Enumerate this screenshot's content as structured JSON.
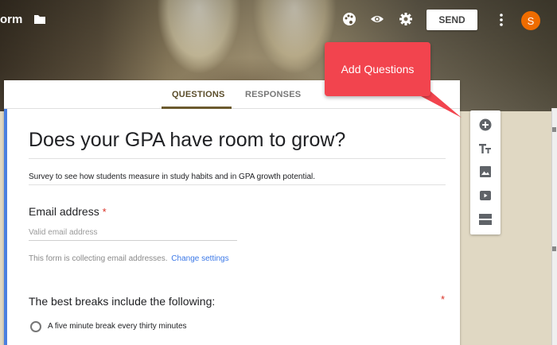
{
  "topbar": {
    "app_title": "orm",
    "send_label": "SEND",
    "avatar_initial": "S"
  },
  "tabs": [
    {
      "label": "QUESTIONS"
    },
    {
      "label": "RESPONSES"
    }
  ],
  "form": {
    "title": "Does your GPA have room to grow?",
    "description": "Survey to see how students measure in study habits and in GPA growth potential."
  },
  "email": {
    "label": "Email address",
    "required_mark": "*",
    "placeholder": "Valid email address",
    "collecting_note": "This form is collecting email addresses.",
    "change_settings": "Change settings"
  },
  "question": {
    "label": "The best breaks include the following:",
    "required_mark": "*",
    "options": [
      "A five minute break every thirty minutes"
    ]
  },
  "callout": {
    "text": "Add Questions"
  },
  "colors": {
    "accent": "#4a7fe0",
    "callout": "#f2444e",
    "avatar": "#ef6c00",
    "link": "#3b78e7"
  },
  "side_toolbar": [
    "add-question-icon",
    "add-title-icon",
    "add-image-icon",
    "add-video-icon",
    "add-section-icon"
  ]
}
